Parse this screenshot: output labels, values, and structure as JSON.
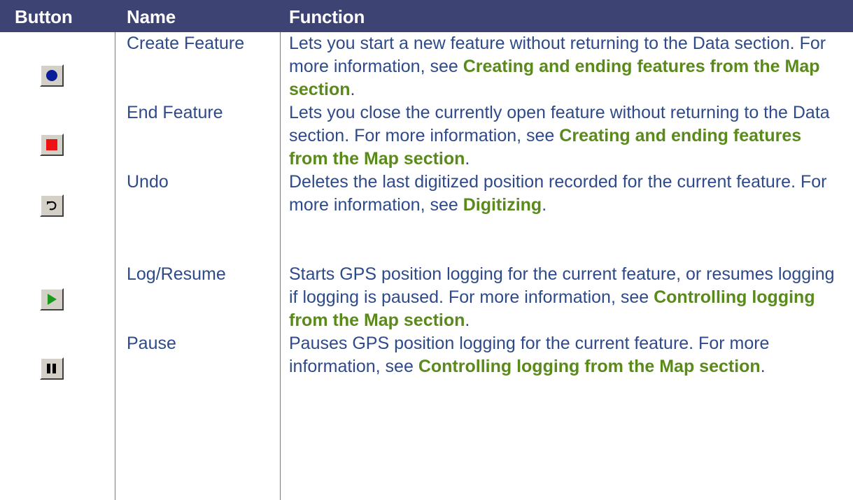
{
  "header": {
    "col_button": "Button",
    "col_name": "Name",
    "col_function": "Function"
  },
  "rows": [
    {
      "icon": "create-feature-icon",
      "name": "Create Feature",
      "text_before": "Lets you start a new feature without returning to the Data section. For more information, see ",
      "link": "Creating and ending features from the Map section",
      "text_after": "."
    },
    {
      "icon": "end-feature-icon",
      "name": "End Feature",
      "text_before": "Lets you close the currently open feature without returning to the Data section. For more information, see ",
      "link": "Creating and ending features from the Map section",
      "text_after": "."
    },
    {
      "icon": "undo-icon",
      "name": "Undo",
      "text_before": "Deletes the last digitized position recorded for the current feature. For more information, see ",
      "link": "Digitizing",
      "text_after": "."
    },
    {
      "icon": "log-resume-icon",
      "name": "Log/Resume",
      "text_before": "Starts GPS position logging for the current feature, or resumes logging if logging is paused. For more information, see ",
      "link": "Controlling logging from the Map section",
      "text_after": "."
    },
    {
      "icon": "pause-icon",
      "name": "Pause",
      "text_before": "Pauses GPS position logging for the current feature. For more information, see ",
      "link": "Controlling logging from the Map section",
      "text_after": "."
    }
  ],
  "colors": {
    "header_bg": "#3d4372",
    "body_text": "#2e4a8a",
    "link_text": "#5a8a1a"
  }
}
